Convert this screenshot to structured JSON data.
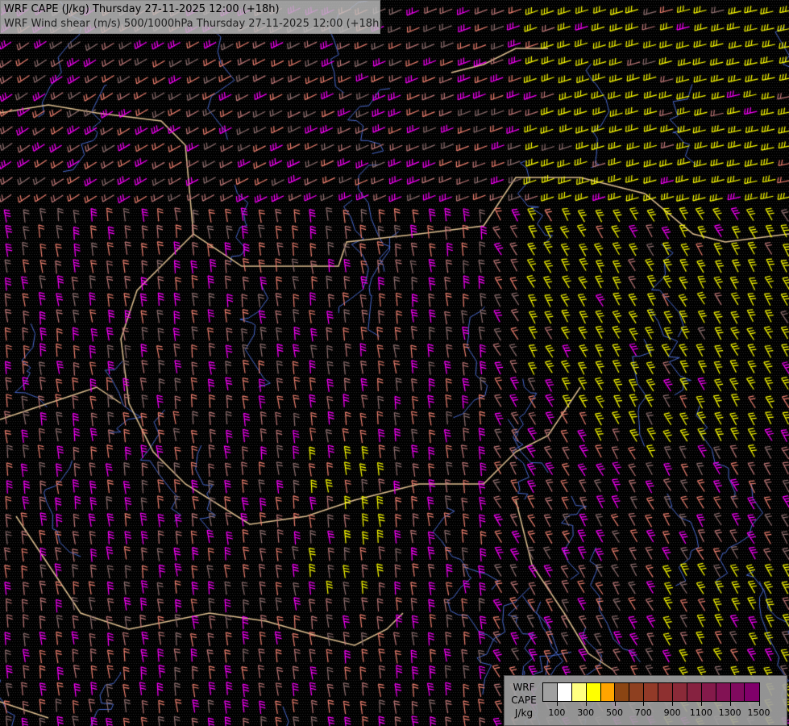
{
  "header": {
    "line1": "WRF CAPE (J/kg) Thursday 27-11-2025 12:00 (+18h)",
    "line2": "WRF Wind shear (m/s) 500/1000hPa Thursday 27-11-2025 12:00 (+18h)"
  },
  "legend": {
    "label_lines": [
      "WRF",
      "CAPE",
      "J/kg"
    ],
    "colors": [
      "#a0a0a0",
      "#ffffff",
      "#ffff80",
      "#ffff00",
      "#ffa500",
      "#8b4513",
      "#8e4020",
      "#923a28",
      "#8e3030",
      "#8a2a38",
      "#862240",
      "#841a4a",
      "#821254",
      "#800a5e",
      "#80006a"
    ],
    "tick_labels": [
      "100",
      "300",
      "500",
      "700",
      "900",
      "1100",
      "1300",
      "1500"
    ]
  },
  "map_colors": {
    "background": "#000000",
    "border": "#e0c090",
    "river": "#4a6ad0",
    "barb_palette": [
      "#ff00ff",
      "#f08070",
      "#c07878",
      "#907070",
      "#ffff00"
    ]
  }
}
